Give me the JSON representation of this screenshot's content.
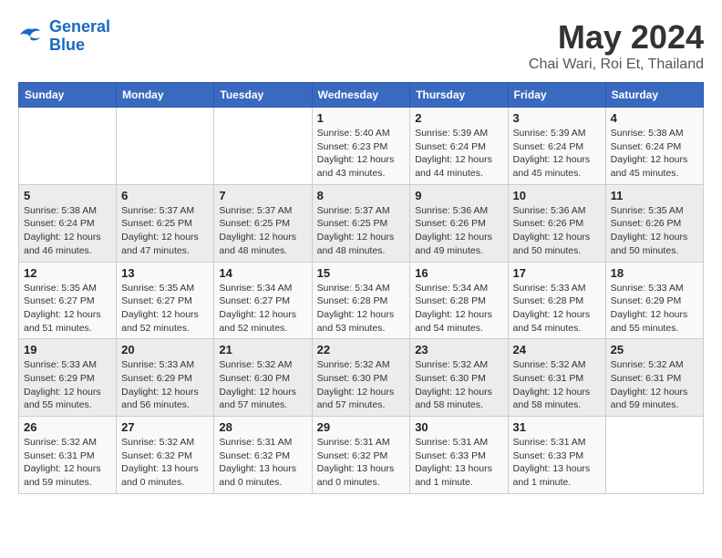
{
  "logo": {
    "line1": "General",
    "line2": "Blue"
  },
  "title": "May 2024",
  "subtitle": "Chai Wari, Roi Et, Thailand",
  "weekdays": [
    "Sunday",
    "Monday",
    "Tuesday",
    "Wednesday",
    "Thursday",
    "Friday",
    "Saturday"
  ],
  "weeks": [
    [
      {
        "day": "",
        "info": ""
      },
      {
        "day": "",
        "info": ""
      },
      {
        "day": "",
        "info": ""
      },
      {
        "day": "1",
        "info": "Sunrise: 5:40 AM\nSunset: 6:23 PM\nDaylight: 12 hours\nand 43 minutes."
      },
      {
        "day": "2",
        "info": "Sunrise: 5:39 AM\nSunset: 6:24 PM\nDaylight: 12 hours\nand 44 minutes."
      },
      {
        "day": "3",
        "info": "Sunrise: 5:39 AM\nSunset: 6:24 PM\nDaylight: 12 hours\nand 45 minutes."
      },
      {
        "day": "4",
        "info": "Sunrise: 5:38 AM\nSunset: 6:24 PM\nDaylight: 12 hours\nand 45 minutes."
      }
    ],
    [
      {
        "day": "5",
        "info": "Sunrise: 5:38 AM\nSunset: 6:24 PM\nDaylight: 12 hours\nand 46 minutes."
      },
      {
        "day": "6",
        "info": "Sunrise: 5:37 AM\nSunset: 6:25 PM\nDaylight: 12 hours\nand 47 minutes."
      },
      {
        "day": "7",
        "info": "Sunrise: 5:37 AM\nSunset: 6:25 PM\nDaylight: 12 hours\nand 48 minutes."
      },
      {
        "day": "8",
        "info": "Sunrise: 5:37 AM\nSunset: 6:25 PM\nDaylight: 12 hours\nand 48 minutes."
      },
      {
        "day": "9",
        "info": "Sunrise: 5:36 AM\nSunset: 6:26 PM\nDaylight: 12 hours\nand 49 minutes."
      },
      {
        "day": "10",
        "info": "Sunrise: 5:36 AM\nSunset: 6:26 PM\nDaylight: 12 hours\nand 50 minutes."
      },
      {
        "day": "11",
        "info": "Sunrise: 5:35 AM\nSunset: 6:26 PM\nDaylight: 12 hours\nand 50 minutes."
      }
    ],
    [
      {
        "day": "12",
        "info": "Sunrise: 5:35 AM\nSunset: 6:27 PM\nDaylight: 12 hours\nand 51 minutes."
      },
      {
        "day": "13",
        "info": "Sunrise: 5:35 AM\nSunset: 6:27 PM\nDaylight: 12 hours\nand 52 minutes."
      },
      {
        "day": "14",
        "info": "Sunrise: 5:34 AM\nSunset: 6:27 PM\nDaylight: 12 hours\nand 52 minutes."
      },
      {
        "day": "15",
        "info": "Sunrise: 5:34 AM\nSunset: 6:28 PM\nDaylight: 12 hours\nand 53 minutes."
      },
      {
        "day": "16",
        "info": "Sunrise: 5:34 AM\nSunset: 6:28 PM\nDaylight: 12 hours\nand 54 minutes."
      },
      {
        "day": "17",
        "info": "Sunrise: 5:33 AM\nSunset: 6:28 PM\nDaylight: 12 hours\nand 54 minutes."
      },
      {
        "day": "18",
        "info": "Sunrise: 5:33 AM\nSunset: 6:29 PM\nDaylight: 12 hours\nand 55 minutes."
      }
    ],
    [
      {
        "day": "19",
        "info": "Sunrise: 5:33 AM\nSunset: 6:29 PM\nDaylight: 12 hours\nand 55 minutes."
      },
      {
        "day": "20",
        "info": "Sunrise: 5:33 AM\nSunset: 6:29 PM\nDaylight: 12 hours\nand 56 minutes."
      },
      {
        "day": "21",
        "info": "Sunrise: 5:32 AM\nSunset: 6:30 PM\nDaylight: 12 hours\nand 57 minutes."
      },
      {
        "day": "22",
        "info": "Sunrise: 5:32 AM\nSunset: 6:30 PM\nDaylight: 12 hours\nand 57 minutes."
      },
      {
        "day": "23",
        "info": "Sunrise: 5:32 AM\nSunset: 6:30 PM\nDaylight: 12 hours\nand 58 minutes."
      },
      {
        "day": "24",
        "info": "Sunrise: 5:32 AM\nSunset: 6:31 PM\nDaylight: 12 hours\nand 58 minutes."
      },
      {
        "day": "25",
        "info": "Sunrise: 5:32 AM\nSunset: 6:31 PM\nDaylight: 12 hours\nand 59 minutes."
      }
    ],
    [
      {
        "day": "26",
        "info": "Sunrise: 5:32 AM\nSunset: 6:31 PM\nDaylight: 12 hours\nand 59 minutes."
      },
      {
        "day": "27",
        "info": "Sunrise: 5:32 AM\nSunset: 6:32 PM\nDaylight: 13 hours\nand 0 minutes."
      },
      {
        "day": "28",
        "info": "Sunrise: 5:31 AM\nSunset: 6:32 PM\nDaylight: 13 hours\nand 0 minutes."
      },
      {
        "day": "29",
        "info": "Sunrise: 5:31 AM\nSunset: 6:32 PM\nDaylight: 13 hours\nand 0 minutes."
      },
      {
        "day": "30",
        "info": "Sunrise: 5:31 AM\nSunset: 6:33 PM\nDaylight: 13 hours\nand 1 minute."
      },
      {
        "day": "31",
        "info": "Sunrise: 5:31 AM\nSunset: 6:33 PM\nDaylight: 13 hours\nand 1 minute."
      },
      {
        "day": "",
        "info": ""
      }
    ]
  ]
}
